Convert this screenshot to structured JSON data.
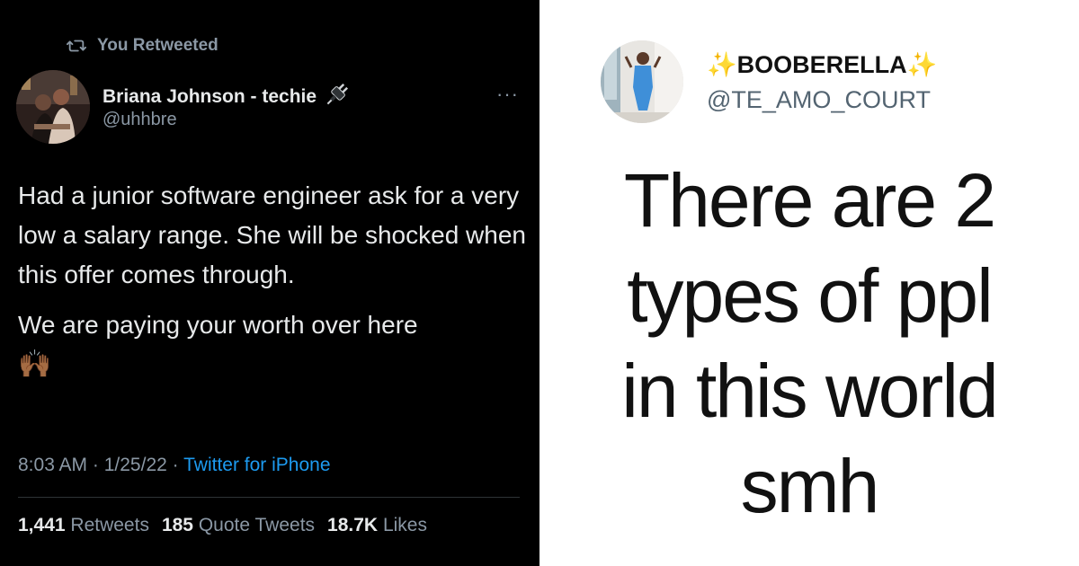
{
  "left_tweet": {
    "retweet_label": "You Retweeted",
    "author_name": "Briana Johnson - techie",
    "author_name_emoji": "🔌",
    "handle": "@uhhbre",
    "more_label": "···",
    "body_paragraph_1": "Had a junior software engineer ask for a very low a salary range. She will be shocked when this offer comes through.",
    "body_paragraph_2": "We are paying your worth over here",
    "body_emoji": "🙌🏾",
    "time": "8:03 AM",
    "date": "1/25/22",
    "separator": " · ",
    "source": "Twitter for iPhone",
    "stats": {
      "retweets_count": "1,441",
      "retweets_label": "Retweets",
      "quotes_count": "185",
      "quotes_label": "Quote Tweets",
      "likes_count": "18.7K",
      "likes_label": "Likes"
    }
  },
  "right_tweet": {
    "author_name": "✨BOOBERELLA✨",
    "handle": "@TE_AMO_COURT",
    "body_lines": [
      "There are 2",
      "types of ppl",
      "in this world",
      "smh"
    ]
  },
  "colors": {
    "dark_bg": "#000000",
    "muted": "#8b98a5",
    "link_blue": "#1d9bf0",
    "light_bg": "#ffffff"
  },
  "icons": [
    "retweet-icon",
    "plug-icon",
    "more-icon",
    "raising-hands-emoji"
  ]
}
